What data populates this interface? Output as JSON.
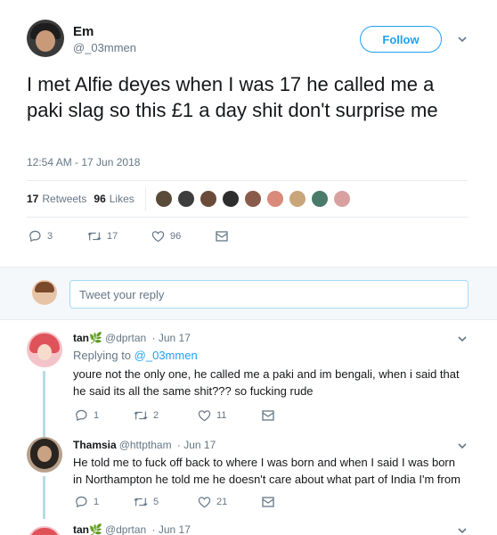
{
  "main_tweet": {
    "author": {
      "name": "Em",
      "handle": "@_03mmen"
    },
    "follow_label": "Follow",
    "text": "I met Alfie deyes when I was 17 he called me a paki slag so this £1 a day shit don't surprise me",
    "timestamp": "12:54 AM - 17 Jun 2018",
    "stats": {
      "retweets_count": "17",
      "retweets_label": "Retweets",
      "likes_count": "96",
      "likes_label": "Likes"
    },
    "liker_avatars": [
      "#5a4a3a",
      "#3d3d3d",
      "#6b4a3a",
      "#2d2d2d",
      "#8a5a4a",
      "#d98a7a",
      "#c9a57a",
      "#4a7a6a",
      "#d9a0a0"
    ],
    "actions": {
      "replies": "3",
      "retweets": "17",
      "likes": "96"
    }
  },
  "compose": {
    "placeholder": "Tweet your reply"
  },
  "replies": [
    {
      "name": "tan",
      "handle": "@dprtan",
      "date": "· Jun 17",
      "replying_to_label": "Replying to",
      "replying_to_handle": "@_03mmen",
      "text": "youre not the only one, he called me a paki and im bengali, when i said that he said its all the same shit??? so fucking rude",
      "actions": {
        "replies": "1",
        "retweets": "2",
        "likes": "11"
      }
    },
    {
      "name": "Thamsia",
      "handle": "@httptham",
      "date": "· Jun 17",
      "text": "He told me to fuck off back to where I was born and when I said I  was born in Northampton he told me he doesn't care about what part of India I'm from",
      "actions": {
        "replies": "1",
        "retweets": "5",
        "likes": "21"
      }
    },
    {
      "name": "tan",
      "handle": "@dprtan",
      "date": "· Jun 17"
    }
  ],
  "colors": {
    "accent": "#1da1f2",
    "muted": "#657786",
    "divider": "#e6ecf0",
    "thread_line": "#b7dbe7"
  },
  "icons": {
    "reply": "reply-icon",
    "retweet": "retweet-icon",
    "like": "heart-icon",
    "dm": "envelope-icon",
    "menu": "chevron-down-icon"
  }
}
